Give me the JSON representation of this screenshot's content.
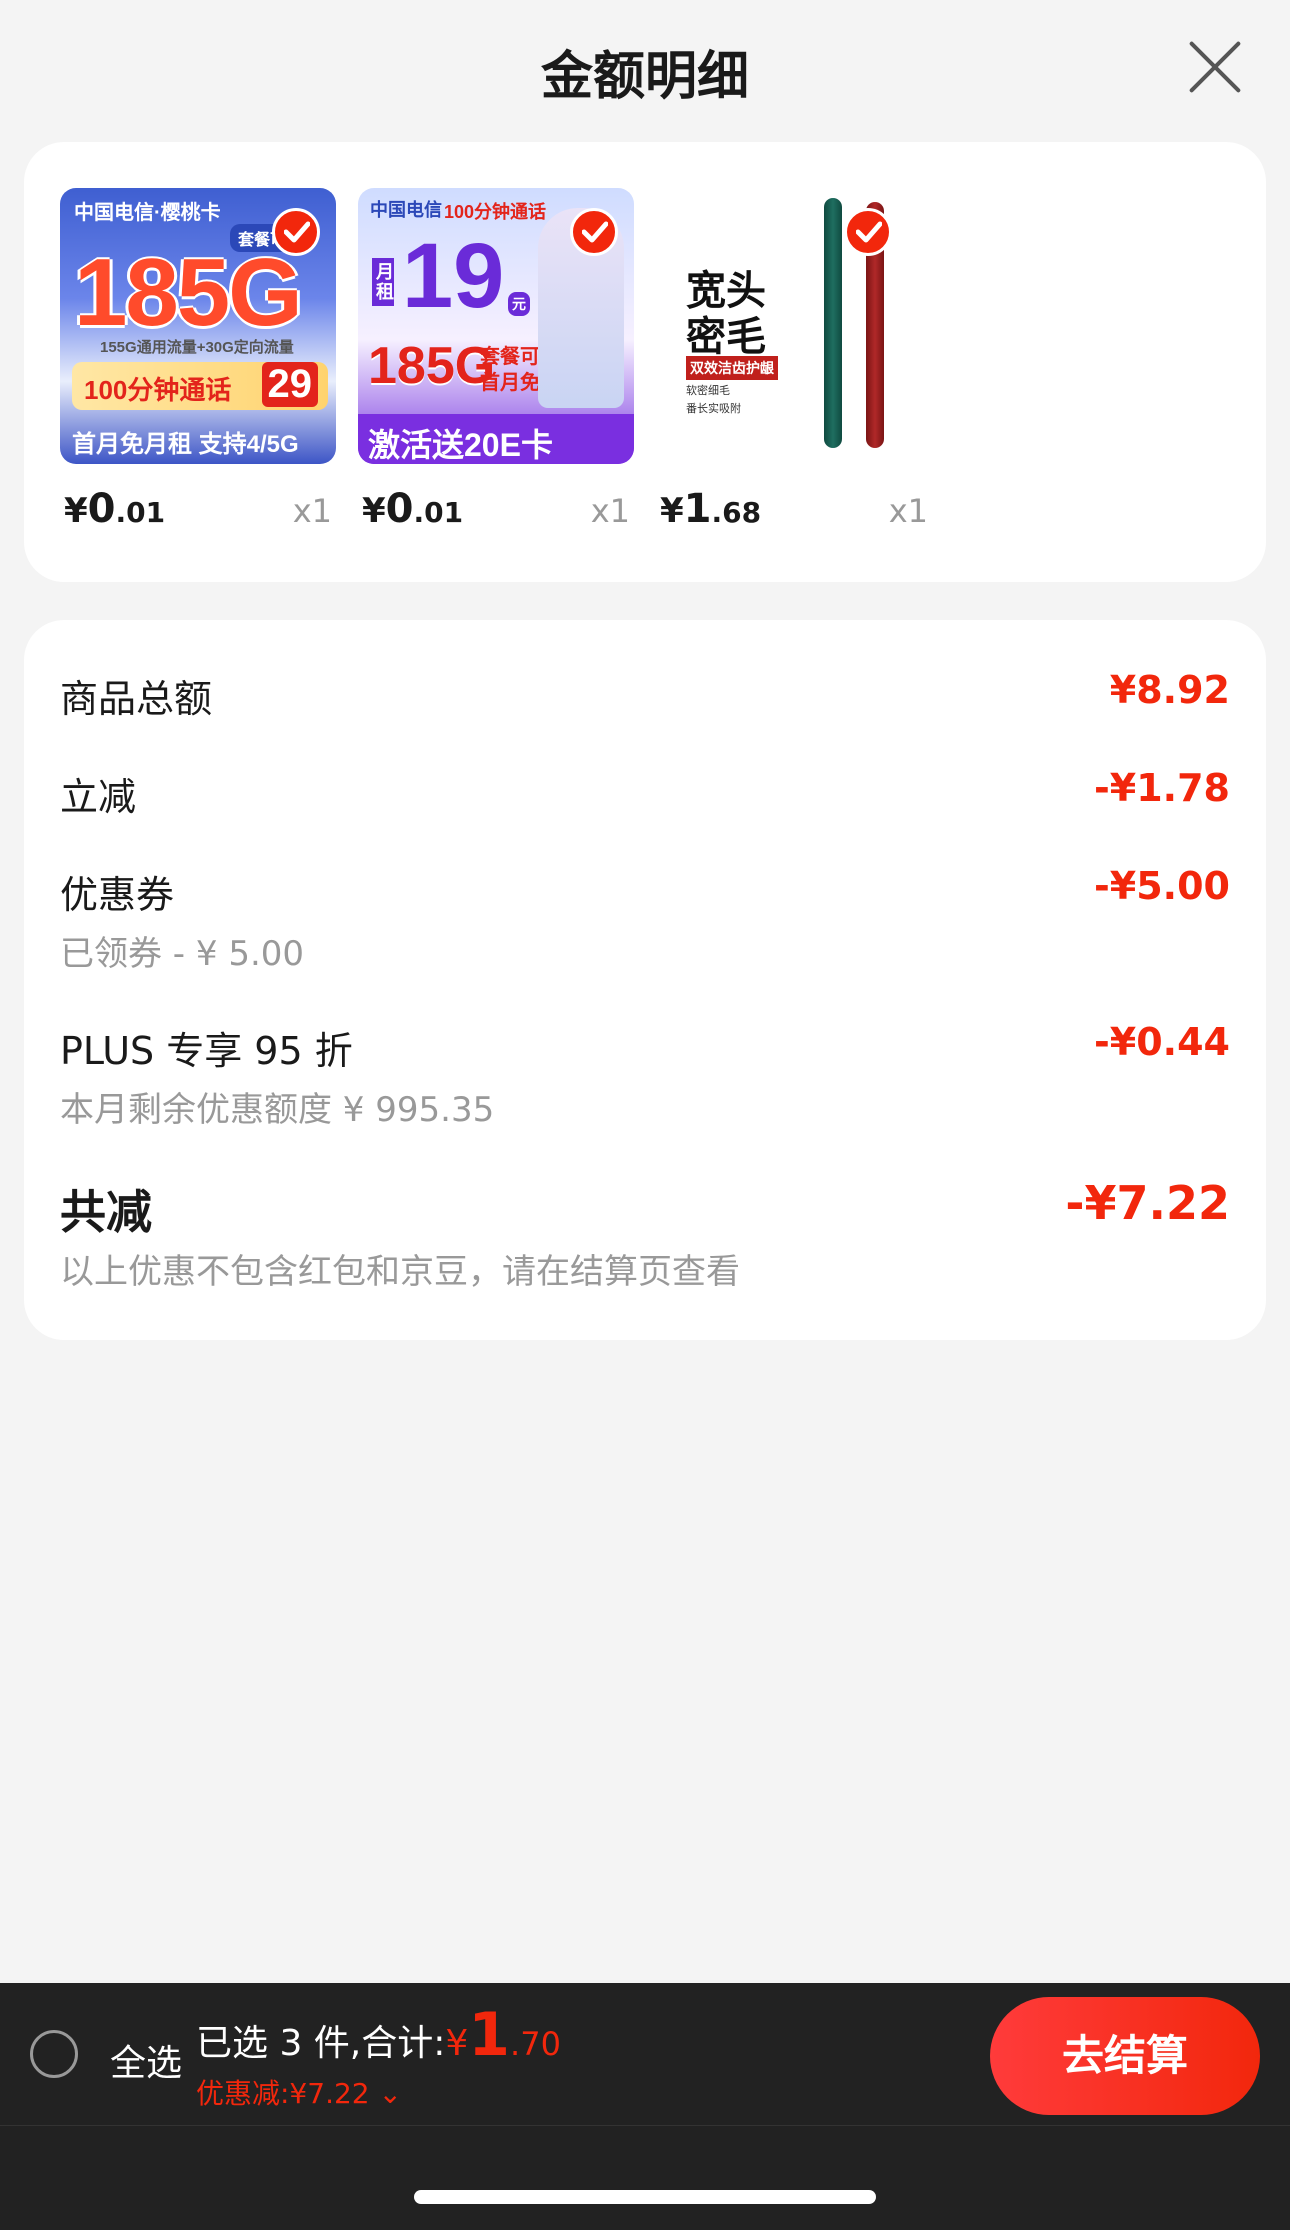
{
  "header": {
    "title": "金额明细",
    "close_icon": "close-icon"
  },
  "products": [
    {
      "thumb": {
        "brand": "中国电信·樱桃卡",
        "tag": "套餐可",
        "big": "185G",
        "sub": "155G通用流量+30G定向流量",
        "band": "100分钟通话",
        "band_price": "29",
        "foot": "首月免月租 支持4/5G"
      },
      "price_symbol": "¥",
      "price_int": "0",
      "price_dec": ".01",
      "qty": "x1"
    },
    {
      "thumb": {
        "brand": "中国电信",
        "tag": "100分钟通话",
        "big": "19",
        "unit": "元",
        "unit_label": "月租",
        "mid": "185G",
        "mid_note1": "套餐可续",
        "mid_note2": "首月免租",
        "foot": "激活送20E卡"
      },
      "price_symbol": "¥",
      "price_int": "0",
      "price_dec": ".01",
      "qty": "x1"
    },
    {
      "thumb": {
        "line1": "宽头",
        "line2": "密毛",
        "badge": "双效洁齿护龈",
        "bullet1": "软密细毛",
        "bullet2": "番长实吸附"
      },
      "price_symbol": "¥",
      "price_int": "1",
      "price_dec": ".68",
      "qty": "x1"
    }
  ],
  "details": {
    "total_label": "商品总额",
    "total_value": "¥8.92",
    "instant_label": "立减",
    "instant_value": "-¥1.78",
    "coupon_label": "优惠券",
    "coupon_sub": "已领券 - ¥ 5.00",
    "coupon_value": "-¥5.00",
    "plus_label": "PLUS 专享 95 折",
    "plus_sub": "本月剩余优惠额度 ¥ 995.35",
    "plus_value": "-¥0.44",
    "sum_label": "共减",
    "sum_sub": "以上优惠不包含红包和京豆，请在结算页查看",
    "sum_value": "-¥7.22"
  },
  "footer": {
    "select_all": "全选",
    "selected_text": "已选 3 件,合计:",
    "currency": "¥",
    "total_int": "1",
    "total_dec": ".70",
    "discount_text": "优惠减:¥7.22 ⌄",
    "checkout_label": "去结算"
  },
  "colors": {
    "accent": "#f2270c",
    "bar_bg": "#222222"
  }
}
